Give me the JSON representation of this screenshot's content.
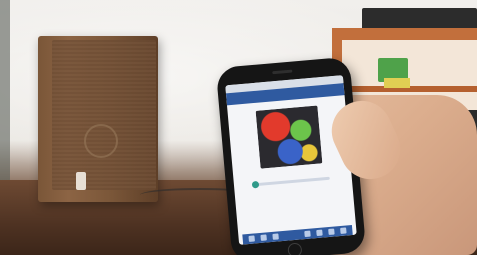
{
  "scene": {
    "description_elements": [
      "speaker",
      "smartphone",
      "hand",
      "shelf",
      "table"
    ]
  },
  "phone": {
    "status_bar_text": "",
    "title_bar_text": "",
    "track_caption": ""
  },
  "colors": {
    "phone_accent": "#2f5aa0",
    "speaker_wood": "#7a5638",
    "shelf_wood": "#c26f3c",
    "progress_dot": "#2f9a8a"
  }
}
